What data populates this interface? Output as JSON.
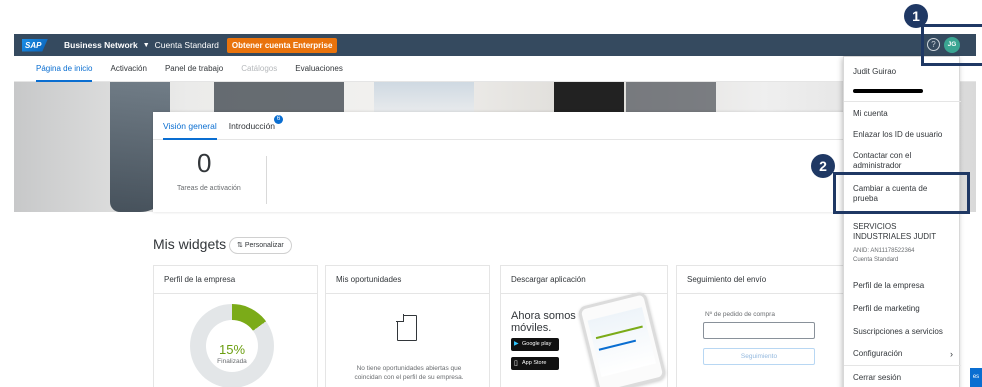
{
  "header": {
    "logo": "SAP",
    "network": "Business Network",
    "account_type": "Cuenta Standard",
    "enterprise_button": "Obtener cuenta Enterprise",
    "help_icon": "?",
    "avatar_initials": "JG"
  },
  "nav": {
    "items": [
      "Página de inicio",
      "Activación",
      "Panel de trabajo",
      "Catálogos",
      "Evaluaciones"
    ]
  },
  "overview": {
    "tabs": [
      "Visión general",
      "Introducción"
    ],
    "intro_badge": "6",
    "count": "0",
    "count_label": "Tareas de activación"
  },
  "widgets": {
    "title": "Mis widgets",
    "personalize_label": "Personalizar",
    "company_profile": {
      "title": "Perfil de la empresa",
      "percent": "15%",
      "percent_value": 0.15,
      "status": "Finalizada"
    },
    "opportunities": {
      "title": "Mis oportunidades",
      "empty_text": "No tiene oportunidades abiertas que coincidan con el perfil de su empresa."
    },
    "download_app": {
      "title": "Descargar aplicación",
      "headline": "Ahora somos móviles.",
      "google_play": "Google play",
      "app_store": "App Store"
    },
    "shipment_tracking": {
      "title": "Seguimiento del envío",
      "po_label": "Nº de pedido de compra",
      "po_value": "",
      "track_button": "Seguimiento"
    }
  },
  "user_menu": {
    "name": "Judit Guirao",
    "items": {
      "my_account": "Mi cuenta",
      "link_ids": "Enlazar los ID de usuario",
      "contact_admin": "Contactar con el administrador",
      "switch_test": "Cambiar a cuenta de prueba",
      "company_name": "SERVICIOS INDUSTRIALES JUDIT",
      "anid": "ANID: AN11178522364",
      "account_type": "Cuenta Standard",
      "company_profile": "Perfil de la empresa",
      "marketing_profile": "Perfil de marketing",
      "service_subscriptions": "Suscripciones a servicios",
      "settings": "Configuración",
      "settings_arrow": "›",
      "logout": "Cerrar sesión"
    }
  },
  "annotations": {
    "step1": "1",
    "step2": "2",
    "color": "#1f3864"
  },
  "feedback_tab": "es",
  "colors": {
    "header_bg": "#354a5f",
    "accent": "#0a6ed1",
    "enterprise_orange": "#e9730c",
    "progress_green": "#7bab18"
  }
}
